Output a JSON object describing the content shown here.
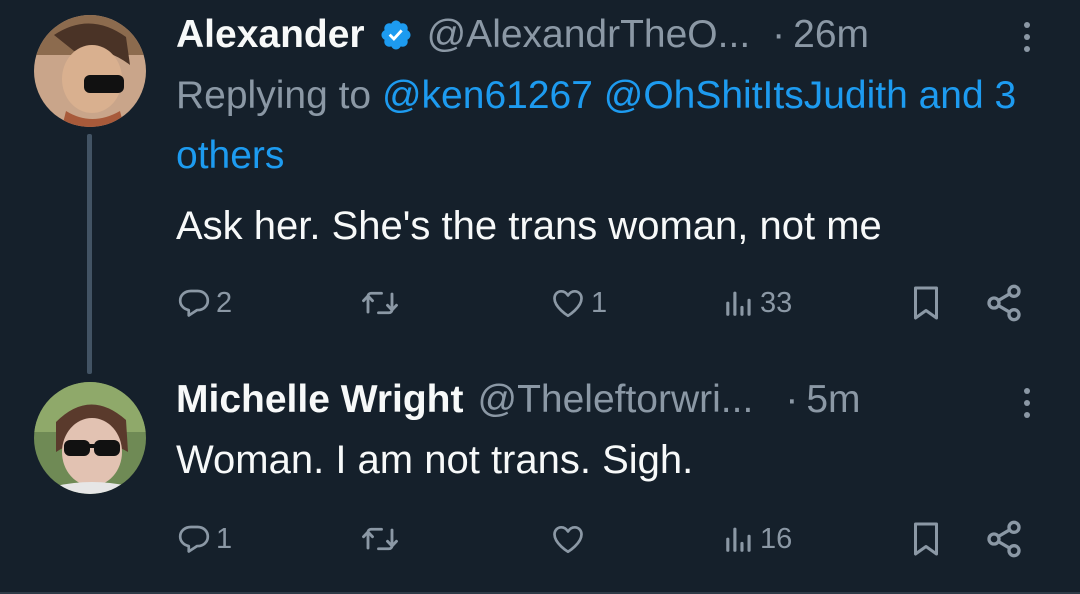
{
  "tweets": [
    {
      "name": "Alexander",
      "handle": "@AlexandrTheO...",
      "time": "26m",
      "reply_prefix": "Replying to",
      "reply_links": "@ken61267 @OhShitItsJudith and 3 others",
      "text": "Ask her. She's the trans woman, not me",
      "replies": "2",
      "retweets": "",
      "likes": "1",
      "views": "33"
    },
    {
      "name": "Michelle Wright",
      "handle": "@Theleftorwri...",
      "time": "5m",
      "text": "Woman. I am not trans. Sigh.",
      "replies": "1",
      "retweets": "",
      "likes": "",
      "views": "16"
    }
  ],
  "colors": {
    "background": "#15202b",
    "link": "#1d9bf0",
    "muted": "#8b98a5",
    "text": "#f7f9f9"
  }
}
